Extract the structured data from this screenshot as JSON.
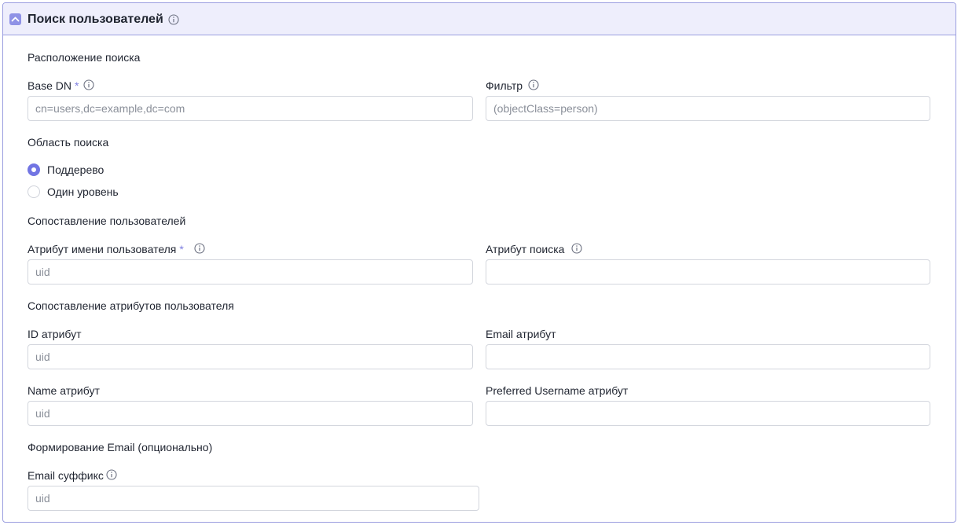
{
  "header": {
    "title": "Поиск пользователей"
  },
  "location": {
    "section_title": "Расположение поиска",
    "base_dn": {
      "label": "Base DN",
      "required_mark": "*",
      "placeholder": "cn=users,dc=example,dc=com",
      "value": ""
    },
    "filter": {
      "label": "Фильтр",
      "placeholder": "(objectClass=person)",
      "value": ""
    }
  },
  "scope": {
    "section_title": "Область поиска",
    "options": [
      {
        "label": "Поддерево",
        "selected": true
      },
      {
        "label": "Один уровень",
        "selected": false
      }
    ]
  },
  "user_mapping": {
    "section_title": "Сопоставление пользователей",
    "username_attr": {
      "label": "Атрибут имени пользователя",
      "required_mark": "*",
      "placeholder": "uid",
      "value": ""
    },
    "search_attr": {
      "label": "Атрибут поиска",
      "placeholder": "",
      "value": ""
    }
  },
  "attr_mapping": {
    "section_title": "Сопоставление атрибутов пользователя",
    "id_attr": {
      "label": "ID атрибут",
      "placeholder": "uid",
      "value": ""
    },
    "email_attr": {
      "label": "Email атрибут",
      "placeholder": "",
      "value": ""
    },
    "name_attr": {
      "label": "Name атрибут",
      "placeholder": "uid",
      "value": ""
    },
    "preferred_username_attr": {
      "label": "Preferred Username атрибут",
      "placeholder": "",
      "value": ""
    }
  },
  "email_forming": {
    "section_title": "Формирование Email (опционально)",
    "email_suffix": {
      "label": "Email суффикс",
      "placeholder": "uid",
      "value": ""
    }
  },
  "colors": {
    "accent": "#7275e3",
    "header_bg": "#eeeefc",
    "border": "#9b9ee0",
    "required": "#7e7fe0"
  },
  "icons": {
    "collapse": "chevron-up-icon",
    "info": "info-icon"
  }
}
